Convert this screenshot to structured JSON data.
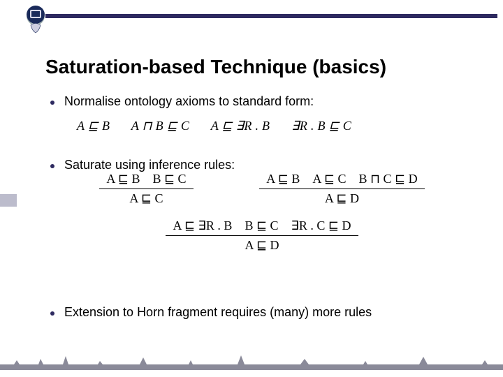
{
  "title": "Saturation-based Technique (basics)",
  "bullets": {
    "b1": "Normalise ontology axioms to standard form:",
    "b2": "Saturate using inference rules:",
    "b3": "Extension to Horn fragment requires (many) more rules"
  },
  "normalForms": {
    "f1": "A ⊑ B",
    "f2": "A ⊓ B ⊑ C",
    "f3": "A ⊑ ∃R . B",
    "f4": "∃R . B ⊑ C"
  },
  "rules": {
    "r1": {
      "prem": "A ⊑ B B ⊑ C",
      "conc": "A ⊑ C"
    },
    "r2": {
      "prem": "A ⊑ B A ⊑ C B ⊓ C ⊑ D",
      "conc": "A ⊑ D"
    },
    "r3": {
      "prem": "A ⊑ ∃R . B B ⊑ C ∃R . C ⊑ D",
      "conc": "A ⊑ D"
    }
  }
}
